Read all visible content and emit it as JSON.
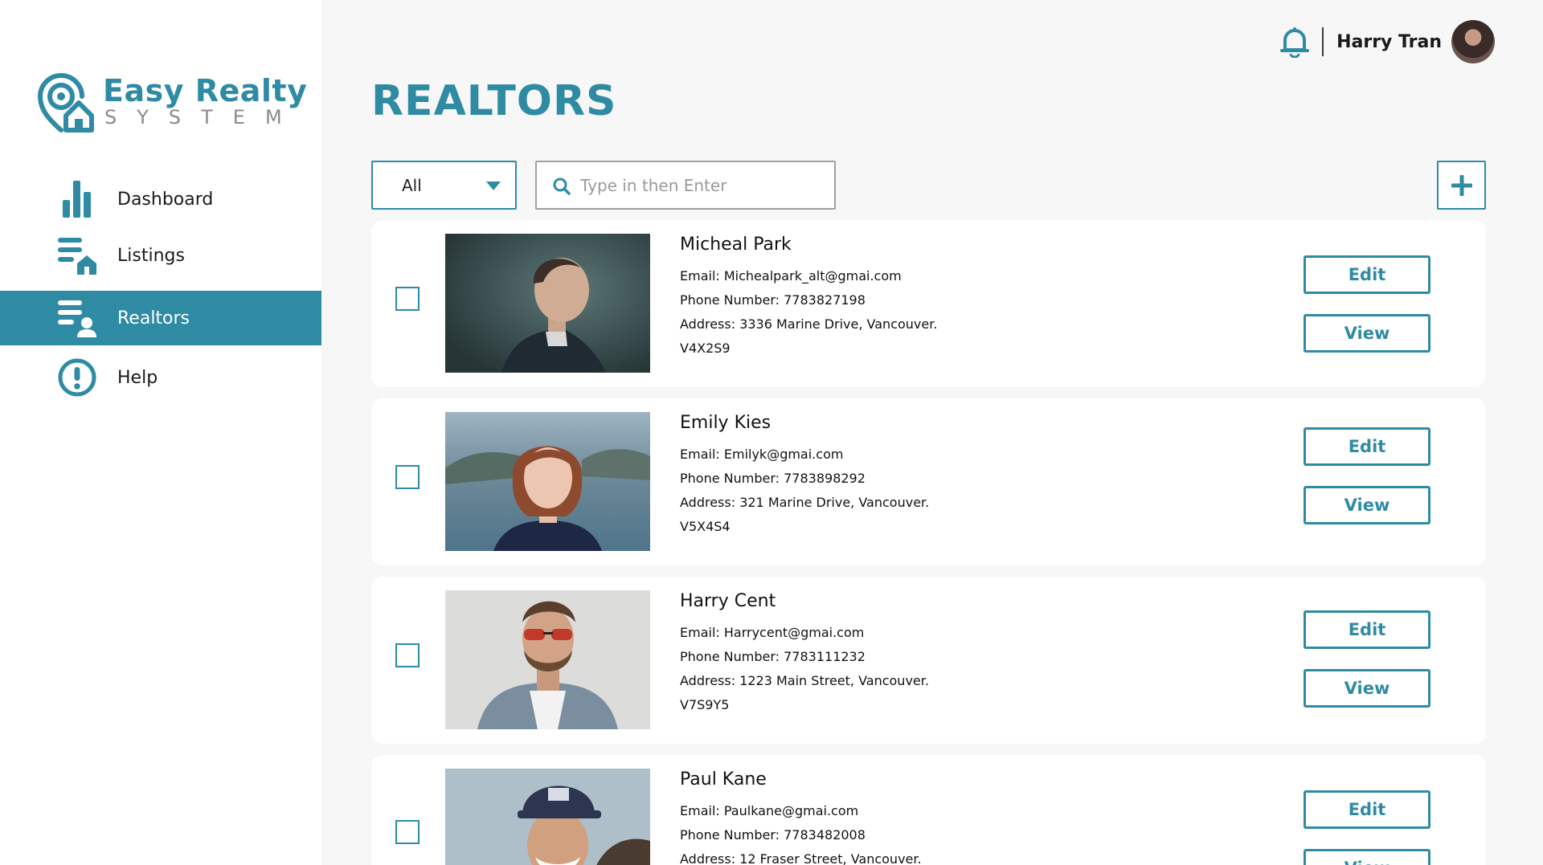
{
  "brand": {
    "title": "Easy Realty",
    "subtitle": "SYSTEM"
  },
  "sidebar": {
    "items": [
      {
        "label": "Dashboard",
        "icon": "bar-chart-icon"
      },
      {
        "label": "Listings",
        "icon": "listings-icon"
      },
      {
        "label": "Realtors",
        "icon": "realtor-icon",
        "active": true
      },
      {
        "label": "Help",
        "icon": "alert-circle-icon"
      }
    ]
  },
  "header": {
    "user_name": "Harry Tran",
    "notification_icon": "bell-icon"
  },
  "main": {
    "title": "REALTORS",
    "filter": {
      "value": "All"
    },
    "search": {
      "placeholder": "Type in then Enter"
    },
    "add_icon": "plus-icon",
    "buttons": {
      "edit": "Edit",
      "view": "View"
    }
  },
  "realtors": [
    {
      "name": "Micheal Park",
      "email": "Email: Michealpark_alt@gmai.com",
      "phone": "Phone Number: 7783827198",
      "address": "Address: 3336 Marine Drive, Vancouver.",
      "postal": "V4X2S9"
    },
    {
      "name": "Emily Kies",
      "email": "Email: Emilyk@gmai.com",
      "phone": "Phone Number: 7783898292",
      "address": "Address: 321 Marine Drive, Vancouver.",
      "postal": "V5X4S4"
    },
    {
      "name": "Harry Cent",
      "email": "Email: Harrycent@gmai.com",
      "phone": "Phone Number: 7783111232",
      "address": "Address: 1223 Main Street, Vancouver.",
      "postal": "V7S9Y5"
    },
    {
      "name": "Paul Kane",
      "email": "Email: Paulkane@gmai.com",
      "phone": "Phone Number: 7783482008",
      "address": "Address: 12 Fraser Street, Vancouver.",
      "postal": ""
    }
  ],
  "colors": {
    "accent": "#2f8ba4",
    "sidebar_bg": "#ffffff",
    "page_bg": "#f7f7f7"
  }
}
